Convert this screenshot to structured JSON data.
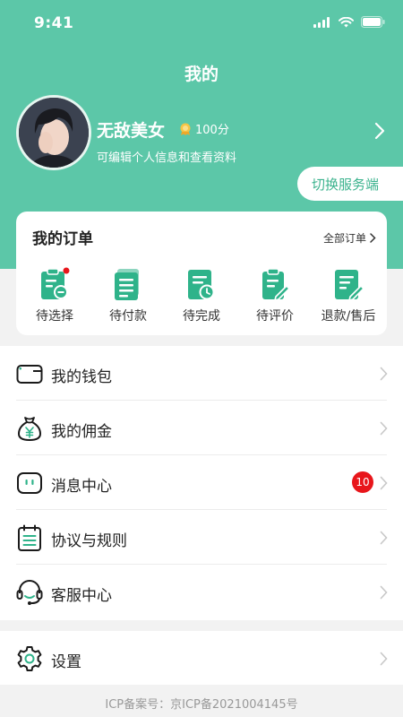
{
  "status_bar": {
    "time": "9:41"
  },
  "header": {
    "title": "我的"
  },
  "profile": {
    "name": "无敌美女",
    "points": "100分",
    "subtitle": "可编辑个人信息和查看资料"
  },
  "switch_button": {
    "label": "切换服务端"
  },
  "orders": {
    "title": "我的订单",
    "all_label": "全部订单",
    "items": [
      {
        "label": "待选择",
        "icon": "pending-select-icon",
        "has_dot": true
      },
      {
        "label": "待付款",
        "icon": "pending-payment-icon"
      },
      {
        "label": "待完成",
        "icon": "pending-complete-icon"
      },
      {
        "label": "待评价",
        "icon": "pending-review-icon"
      },
      {
        "label": "退款/售后",
        "icon": "refund-icon"
      }
    ]
  },
  "menu": [
    {
      "label": "我的钱包",
      "icon": "wallet-icon"
    },
    {
      "label": "我的佣金",
      "icon": "commission-icon"
    },
    {
      "label": "消息中心",
      "icon": "message-icon",
      "badge": "10"
    },
    {
      "label": "协议与规则",
      "icon": "agreement-icon"
    },
    {
      "label": "客服中心",
      "icon": "customer-service-icon"
    }
  ],
  "settings": {
    "label": "设置",
    "icon": "settings-icon"
  },
  "footer": {
    "icp": "ICP备案号：京ICP备2021004145号"
  },
  "colors": {
    "accent": "#5cc7a8",
    "accent_dark": "#2fb38a",
    "badge": "#e8161b",
    "dot": "#e8161b"
  }
}
